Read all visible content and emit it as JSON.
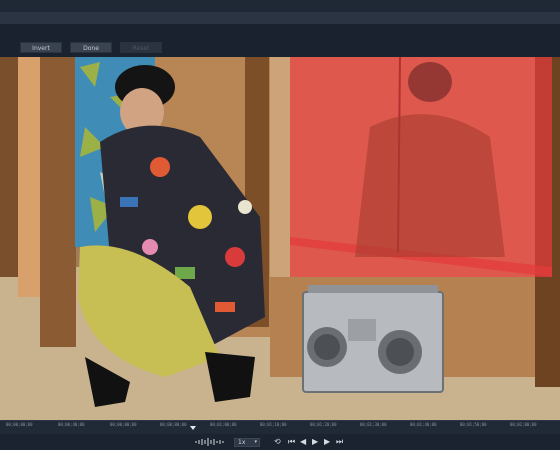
{
  "toolbar": {
    "invert_label": "Invert",
    "done_label": "Done",
    "reset_label": "Reset"
  },
  "timeline": {
    "ticks": [
      "00;00;00;00",
      "00;00;00;00",
      "00;00;00;00",
      "00;00;00;00",
      "00;00;00;00",
      "00;00;00;00",
      "00;00;00;00",
      "00;00;00;00",
      "00;00;00;00",
      "00;00;00;00",
      "00;00;00;00"
    ],
    "tick_labels_visible": [
      "00;00;00;00",
      "00;00;40;00",
      "00;00;00;00",
      "00;00;00;00",
      "00;01;00;00",
      "00;01;10;00",
      "00;01;20;00",
      "00;01;30;00",
      "00;01;40;00",
      "00;01;50;00",
      "00;02;00;00"
    ]
  },
  "transport": {
    "speed_value": "1x",
    "icons": [
      "waveform-icon",
      "loop-icon",
      "skip-start-icon",
      "step-back-icon",
      "play-icon",
      "step-forward-icon",
      "skip-end-icon"
    ]
  },
  "colors": {
    "mask_overlay": "#e53b3b",
    "background": "#1b2330"
  }
}
